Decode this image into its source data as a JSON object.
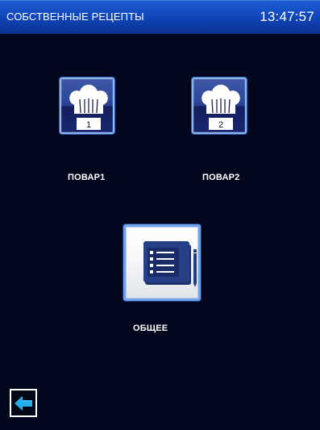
{
  "header": {
    "title": "СОБСТВЕННЫЕ РЕЦЕПТЫ",
    "time": "13:47:57"
  },
  "chefs": [
    {
      "number": "1",
      "label": "ПОВАР1"
    },
    {
      "number": "2",
      "label": "ПОВАР2"
    }
  ],
  "general": {
    "label": "ОБЩЕЕ"
  },
  "colors": {
    "header": "#0f44b6",
    "background": "#02071d",
    "accent": "#22aee8"
  },
  "icons": {
    "chef_tile": "chef-hat-icon",
    "general_tile": "recipe-book-icon",
    "back": "back-arrow-icon"
  }
}
